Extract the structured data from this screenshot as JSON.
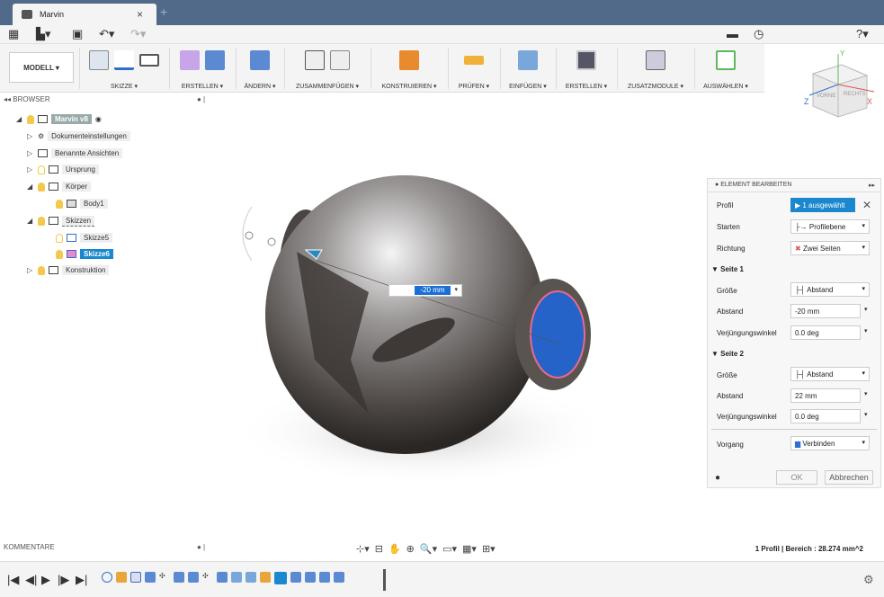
{
  "tab": {
    "title": "Marvin",
    "close": "×",
    "new": "+"
  },
  "ribbon": {
    "workspace": "MODELL ▾",
    "groups": [
      "SKIZZE ▾",
      "ERSTELLEN ▾",
      "ÄNDERN ▾",
      "ZUSAMMENFÜGEN ▾",
      "KONSTRUIEREN ▾",
      "PRÜFEN ▾",
      "EINFÜGEN ▾",
      "ERSTELLEN ▾",
      "ZUSATZMODULE ▾",
      "AUSWÄHLEN ▾"
    ]
  },
  "viewcube": {
    "front": "VORNE",
    "right": "RECHTS",
    "x": "X",
    "y": "Y",
    "z": "Z"
  },
  "browser": {
    "header": "BROWSER",
    "items": [
      {
        "label": "Marvin v8"
      },
      {
        "label": "Dokumenteinstellungen"
      },
      {
        "label": "Benannte Ansichten"
      },
      {
        "label": "Ursprung"
      },
      {
        "label": "Körper"
      },
      {
        "label": "Body1"
      },
      {
        "label": "Skizzen"
      },
      {
        "label": "Skizze5"
      },
      {
        "label": "Skizze6"
      },
      {
        "label": "Konstruktion"
      }
    ]
  },
  "dimension": {
    "value": "-20 mm"
  },
  "panel": {
    "title": "ELEMENT BEARBEITEN",
    "profil_label": "Profil",
    "profil_value": "1 ausgewählt",
    "starten_label": "Starten",
    "starten_value": "Profilebene",
    "richtung_label": "Richtung",
    "richtung_value": "Zwei Seiten",
    "seite1": "▼ Seite 1",
    "s1_groesse_label": "Größe",
    "s1_groesse_value": "Abstand",
    "s1_abstand_label": "Abstand",
    "s1_abstand_value": "-20 mm",
    "s1_winkel_label": "Verjüngungswinkel",
    "s1_winkel_value": "0.0 deg",
    "seite2": "▼ Seite 2",
    "s2_groesse_label": "Größe",
    "s2_groesse_value": "Abstand",
    "s2_abstand_label": "Abstand",
    "s2_abstand_value": "22 mm",
    "s2_winkel_label": "Verjüngungswinkel",
    "s2_winkel_value": "0.0 deg",
    "vorgang_label": "Vorgang",
    "vorgang_value": "Verbinden",
    "ok": "OK",
    "cancel": "Abbrechen"
  },
  "comments": {
    "label": "KOMMENTARE"
  },
  "status": {
    "text": "1 Profil | Bereich : 28.274 mm^2"
  }
}
